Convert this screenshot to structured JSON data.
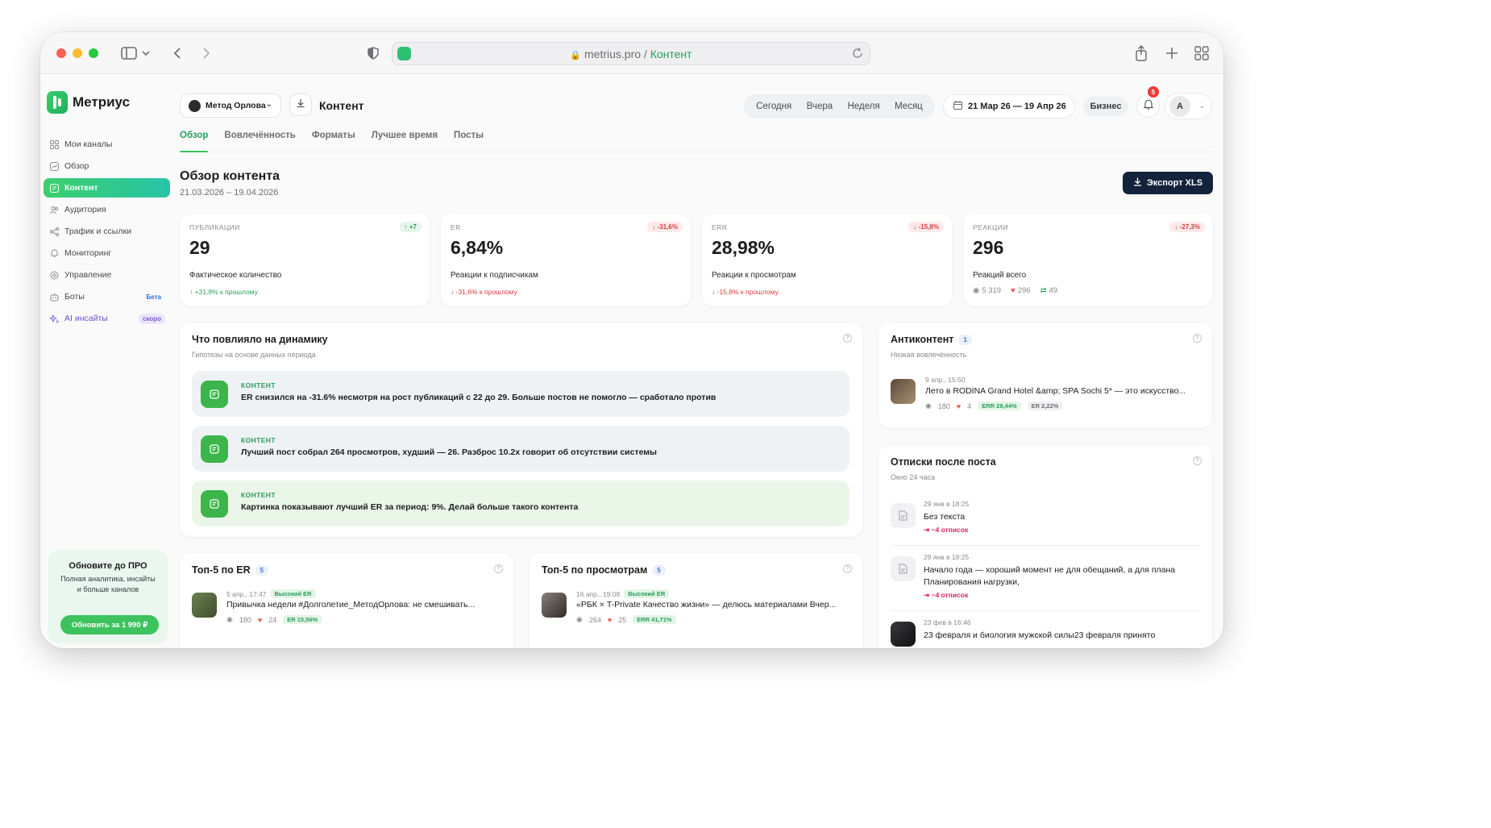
{
  "browser": {
    "url_domain": "metrius.pro",
    "url_sep": " / ",
    "url_path": "Контент"
  },
  "app": {
    "name": "Метриус"
  },
  "sidebar": {
    "items": [
      {
        "label": "Мои каналы",
        "icon": "grid-icon"
      },
      {
        "label": "Обзор",
        "icon": "chart-icon"
      },
      {
        "label": "Контент",
        "icon": "content-icon",
        "active": true
      },
      {
        "label": "Аудитория",
        "icon": "users-icon"
      },
      {
        "label": "Трафик и ссылки",
        "icon": "share-icon"
      },
      {
        "label": "Мониторинг",
        "icon": "bell-icon"
      },
      {
        "label": "Управление",
        "icon": "gear-icon"
      },
      {
        "label": "Боты",
        "icon": "bot-icon",
        "badge": "Бета"
      },
      {
        "label": "AI инсайты",
        "icon": "sparkle-icon",
        "badge": "скоро"
      }
    ],
    "promo": {
      "title": "Обновите до ПРО",
      "text": "Полная аналитика, инсайты и больше каналов",
      "button": "Обновить за 1 990 ₽"
    }
  },
  "header": {
    "channel": "Метод Орлова",
    "page_title": "Контент",
    "periods": [
      "Сегодня",
      "Вчера",
      "Неделя",
      "Месяц"
    ],
    "date_range": "21 Мар 26 — 19 Апр 26",
    "plan": "Бизнес",
    "notifications": "5",
    "user_initial": "А"
  },
  "tabs": [
    "Обзор",
    "Вовлечённость",
    "Форматы",
    "Лучшее время",
    "Посты"
  ],
  "page": {
    "title": "Обзор контента",
    "range": "21.03.2026 – 19.04.2026",
    "export": "Экспорт XLS"
  },
  "stats": [
    {
      "label": "ПУБЛИКАЦИИ",
      "delta": "+7",
      "dir": "up",
      "value": "29",
      "desc": "Фактическое количество",
      "note": "+31,8% к прошлому"
    },
    {
      "label": "ER",
      "delta": "-31,6%",
      "dir": "down",
      "value": "6,84%",
      "desc": "Реакции к подписчикам",
      "note": "-31,6% к прошлому"
    },
    {
      "label": "ERR",
      "delta": "-15,8%",
      "dir": "down",
      "value": "28,98%",
      "desc": "Реакции к просмотрам",
      "note": "-15,8% к прошлому"
    },
    {
      "label": "РЕАКЦИИ",
      "delta": "-27,3%",
      "dir": "down",
      "value": "296",
      "desc": "Реакций всего",
      "views": "5 319",
      "likes": "296",
      "reposts": "49"
    }
  ],
  "dynamics": {
    "title": "Что повлияло на динамику",
    "subtitle": "Гипотезы на основе данных периода",
    "items": [
      {
        "category": "КОНТЕНТ",
        "text": "ER снизился на -31.6% несмотря на рост публикаций с 22 до 29. Больше постов не помогло — сработало против"
      },
      {
        "category": "КОНТЕНТ",
        "text": "Лучший пост собрал 264 просмотров, худший — 26. Разброс 10.2x говорит об отсутствии системы"
      },
      {
        "category": "КОНТЕНТ",
        "text": "Картинка показывают лучший ER за период: 9%. Делай больше такого контента"
      }
    ]
  },
  "anticontent": {
    "title": "Антиконтент",
    "count": "1",
    "subtitle": "Низкая вовлечённость",
    "post": {
      "date": "9 апр., 15:50",
      "text": "Лето в RODINA Grand Hotel &amp; SPA Sochi 5* — это искусство...",
      "views": "180",
      "likes": "4",
      "err": "ERR 28,44%",
      "er": "ER 2,22%"
    }
  },
  "unsubs": {
    "title": "Отписки после поста",
    "subtitle": "Окно 24 часа",
    "items": [
      {
        "date": "29 янв в 18:25",
        "text": "Без текста",
        "count": "−4 отписок"
      },
      {
        "date": "29 янв в 18:25",
        "text": "Начало года — хороший момент не для обещаний, а для плана Планирования нагрузки,",
        "count": "−4 отписок"
      },
      {
        "date": "23 фев в 16:46",
        "text": "23 февраля и биология мужской силы23 февраля принято"
      }
    ]
  },
  "top_er": {
    "title": "Топ-5 по ER",
    "count": "5",
    "post": {
      "date": "5 апр., 17:47",
      "tag": "Высокий ER",
      "text": "Привычка недели #Долголетие_МетодОрлова: не смешивать...",
      "views": "180",
      "likes": "24",
      "er": "ER 15,56%"
    }
  },
  "top_views": {
    "title": "Топ-5 по просмотрам",
    "count": "5",
    "post": {
      "date": "16 апр., 19:08",
      "tag": "Высокий ER",
      "text": "«РБК × T-Private Качество жизни» — делюсь материалами Вчер...",
      "views": "264",
      "likes": "25",
      "er": "ERR 41,71%"
    }
  }
}
